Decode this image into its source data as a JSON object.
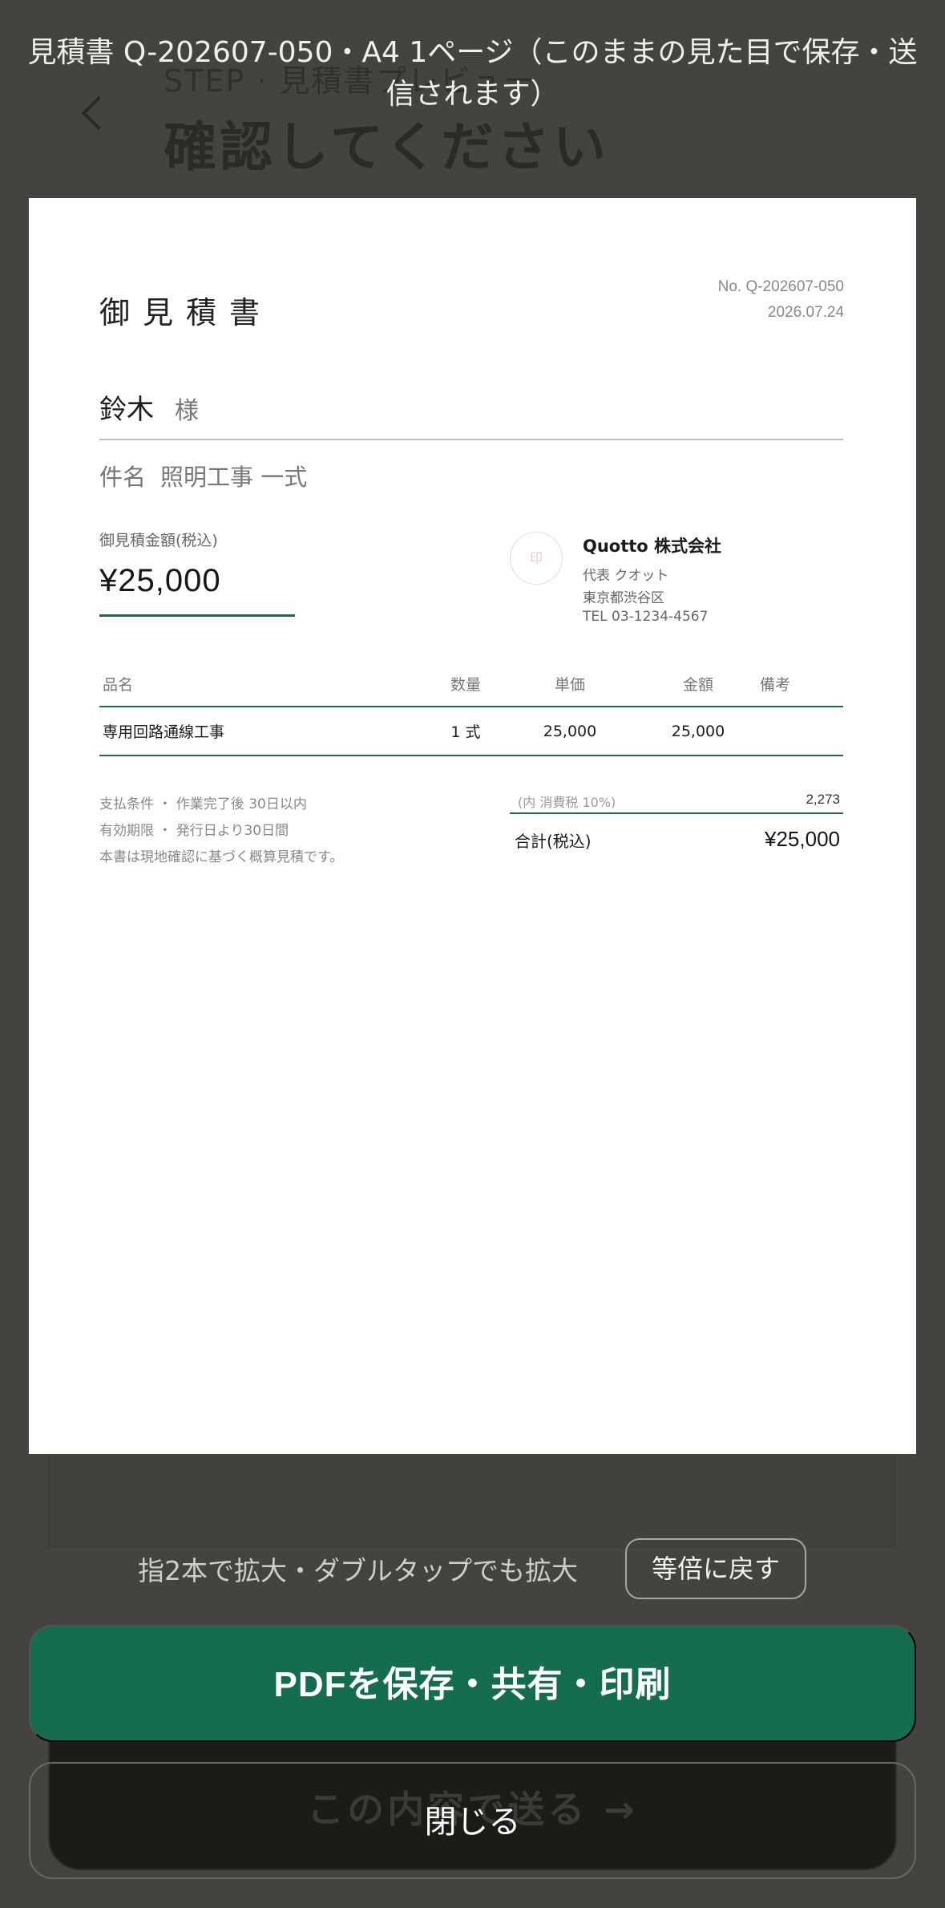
{
  "underlying": {
    "step": "STEP · 見積書プレビュー",
    "title": "確認してください",
    "send_button": "この内容で送る →"
  },
  "caption": "見積書 Q-202607-050・A4 1ページ（このままの見た目で保存・送信されます）",
  "document": {
    "title": "御見積書",
    "number": "No. Q-202607-050",
    "date": "2026.07.24",
    "customer": "鈴木",
    "honorific": "様",
    "subject_label": "件名",
    "subject": "照明工事 一式",
    "amount_label": "御見積金額(税込)",
    "amount": "¥25,000",
    "seal": "印",
    "company": {
      "name": "Quotto 株式会社",
      "rep": "代表 クオット",
      "address": "東京都渋谷区",
      "tel": "TEL 03-1234-4567"
    },
    "table": {
      "headers": [
        "品名",
        "数量",
        "単価",
        "金額",
        "備考"
      ],
      "rows": [
        [
          "専用回路通線工事",
          "1 式",
          "25,000",
          "25,000",
          ""
        ]
      ]
    },
    "terms": [
      "支払条件 ・ 作業完了後 30日以内",
      "有効期限 ・ 発行日より30日間",
      "本書は現地確認に基づく概算見積です。"
    ],
    "tax_label": "(内 消費税 10%)",
    "tax_value": "2,273",
    "total_label": "合計(税込)",
    "total_value": "¥25,000"
  },
  "zoom_hint": "指2本で拡大・ダブルタップでも拡大",
  "reset_button": "等倍に戻す",
  "primary_button": "PDFを保存・共有・印刷",
  "close_button": "閉じる",
  "colors": {
    "accent": "#146d50",
    "overlay": "#45433f"
  }
}
